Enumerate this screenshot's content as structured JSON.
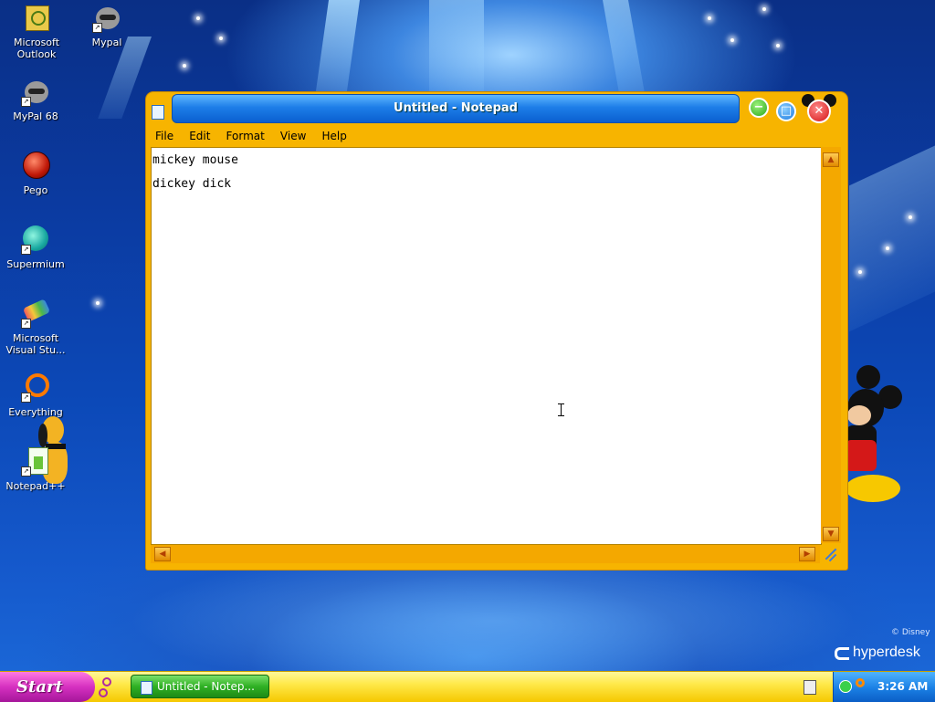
{
  "desktop": {
    "icons": [
      {
        "label": "Microsoft Outlook",
        "icon": "outlook-icon"
      },
      {
        "label": "Mypal",
        "icon": "mypal-raccoon-icon"
      },
      {
        "label": "MyPal 68",
        "icon": "mypal68-raccoon-icon"
      },
      {
        "label": "Pego",
        "icon": "pego-ball-icon"
      },
      {
        "label": "Supermium",
        "icon": "supermium-icon"
      },
      {
        "label": "Microsoft Visual Stu...",
        "icon": "visual-studio-icon"
      },
      {
        "label": "Everything",
        "icon": "everything-search-icon"
      },
      {
        "label": "Notepad++",
        "icon": "notepadpp-icon"
      }
    ],
    "brand": "hyperdesk",
    "copyright": "© Disney"
  },
  "notepad": {
    "title": "Untitled - Notepad",
    "menu": [
      "File",
      "Edit",
      "Format",
      "View",
      "Help"
    ],
    "lines": [
      "mickey mouse",
      "dickey dick"
    ],
    "accent": "#f7b400",
    "title_color": "#1d7ee8"
  },
  "taskbar": {
    "start_label": "Start",
    "task_label": "Untitled - Notep...",
    "clock": "3:26 AM"
  }
}
